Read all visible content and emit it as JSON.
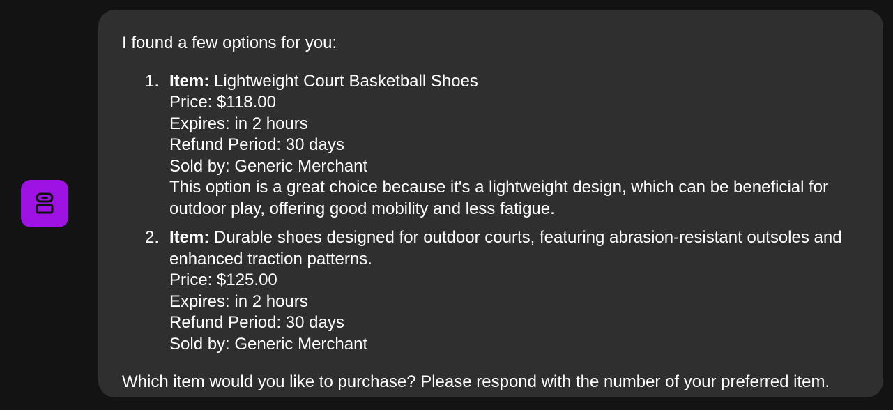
{
  "assistant": {
    "avatar_icon": "robot-icon",
    "avatar_color": "#9e12e4"
  },
  "message": {
    "intro": "I found a few options for you:",
    "options": [
      {
        "number": "1.",
        "item_label": "Item:",
        "item_text": "Lightweight Court Basketball Shoes",
        "price": "Price: $118.00",
        "expires": "Expires: in 2 hours",
        "refund": "Refund Period: 30 days",
        "sold_by": "Sold by: Generic Merchant",
        "note": "This option is a great choice because it's a lightweight design, which can be beneficial for outdoor play, offering good mobility and less fatigue."
      },
      {
        "number": "2.",
        "item_label": "Item:",
        "item_text": "Durable shoes designed for outdoor courts, featuring abrasion-resistant outsoles and enhanced traction patterns.",
        "price": "Price: $125.00",
        "expires": "Expires: in 2 hours",
        "refund": "Refund Period: 30 days",
        "sold_by": "Sold by: Generic Merchant"
      }
    ],
    "outro": "Which item would you like to purchase? Please respond with the number of your preferred item."
  }
}
